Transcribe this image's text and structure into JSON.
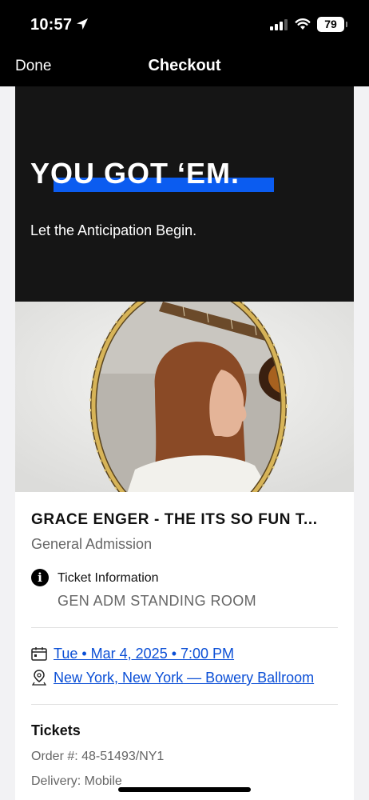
{
  "status_bar": {
    "time": "10:57",
    "battery": "79"
  },
  "nav": {
    "done_label": "Done",
    "title": "Checkout"
  },
  "hero": {
    "title": "YOU GOT ‘EM.",
    "subtitle": "Let the Anticipation Begin.",
    "accent_color": "#0b5cf0"
  },
  "event": {
    "title": "GRACE ENGER - THE ITS SO FUN T...",
    "admission": "General Admission",
    "ticket_info_label": "Ticket Information",
    "ticket_info_value": "GEN ADM STANDING ROOM",
    "date_link": "Tue • Mar 4, 2025 • 7:00 PM",
    "venue_link": "New York, New York — Bowery Ballroom"
  },
  "tickets": {
    "heading": "Tickets",
    "order": "Order #: 48-51493/NY1",
    "delivery": "Delivery: Mobile"
  }
}
